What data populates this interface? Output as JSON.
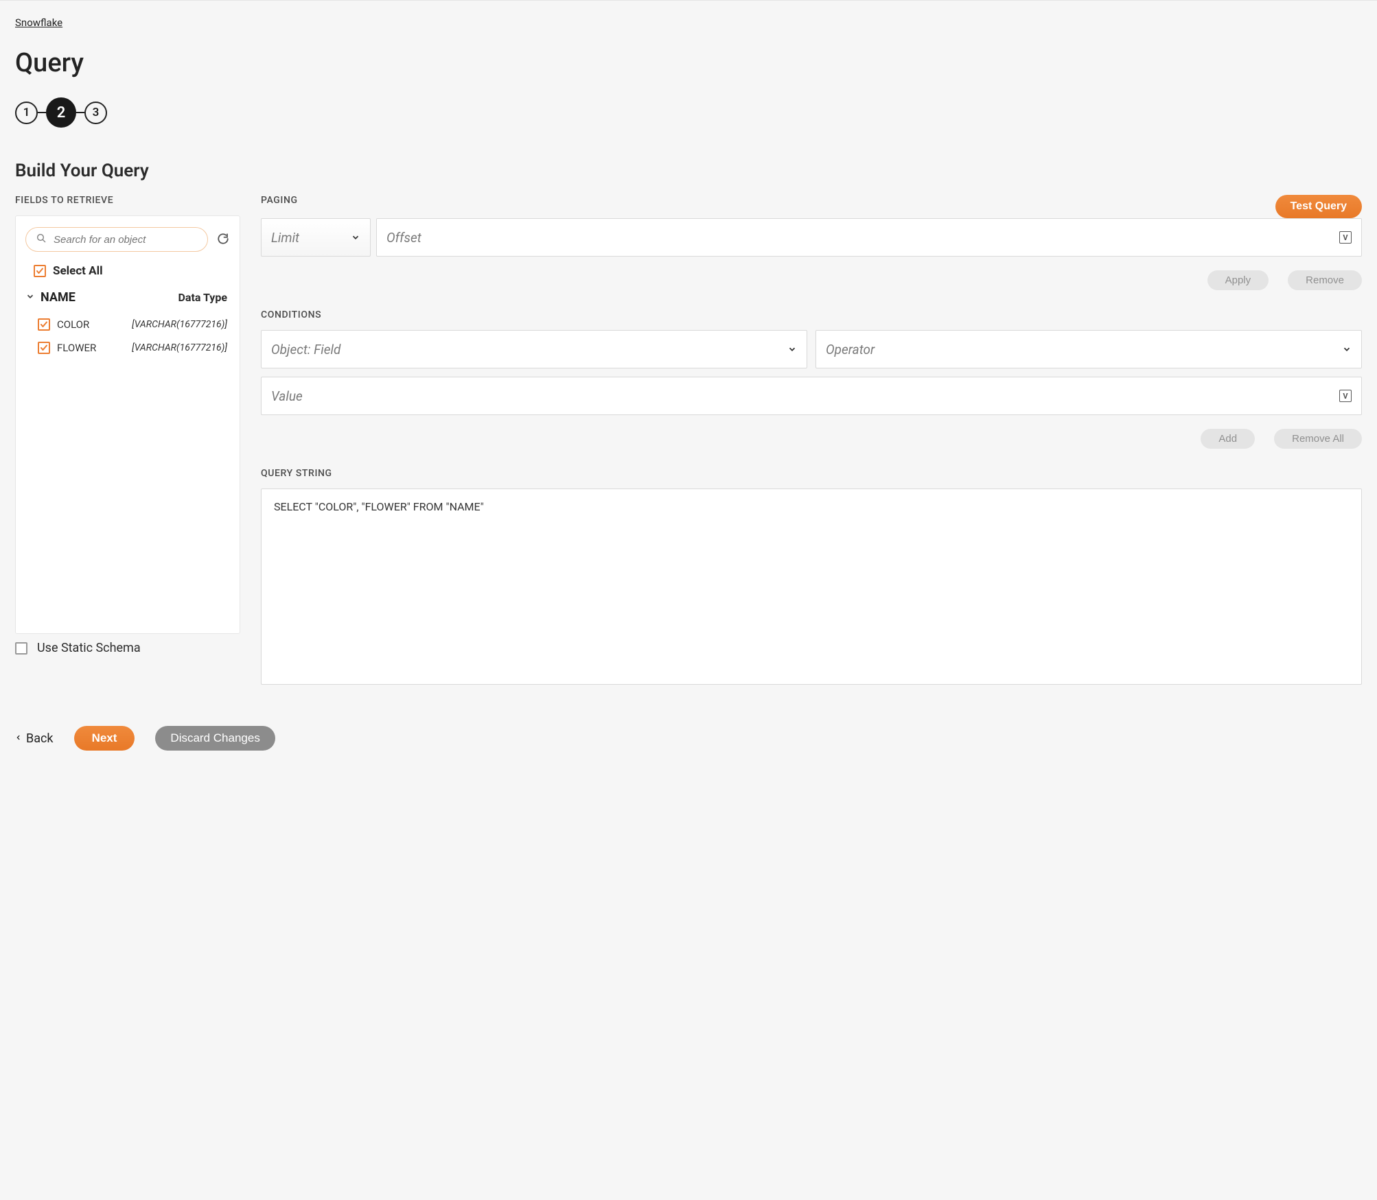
{
  "breadcrumb": "Snowflake",
  "page_title": "Query",
  "stepper": {
    "steps": [
      "1",
      "2",
      "3"
    ],
    "active_index": 1
  },
  "section_title": "Build Your Query",
  "fields": {
    "label": "FIELDS TO RETRIEVE",
    "search_placeholder": "Search for an object",
    "select_all": "Select All",
    "object_header": "NAME",
    "datatype_header": "Data Type",
    "items": [
      {
        "name": "COLOR",
        "type": "[VARCHAR(16777216)]",
        "checked": true
      },
      {
        "name": "FLOWER",
        "type": "[VARCHAR(16777216)]",
        "checked": true
      }
    ],
    "static_schema": "Use Static Schema"
  },
  "right": {
    "test_query": "Test Query",
    "paging": {
      "label": "PAGING",
      "limit_placeholder": "Limit",
      "offset_placeholder": "Offset",
      "apply": "Apply",
      "remove": "Remove"
    },
    "conditions": {
      "label": "CONDITIONS",
      "object_field_placeholder": "Object: Field",
      "operator_placeholder": "Operator",
      "value_placeholder": "Value",
      "add": "Add",
      "remove_all": "Remove All"
    },
    "query_string": {
      "label": "QUERY STRING",
      "value": "SELECT \"COLOR\", \"FLOWER\" FROM \"NAME\""
    }
  },
  "footer": {
    "back": "Back",
    "next": "Next",
    "discard": "Discard Changes"
  }
}
